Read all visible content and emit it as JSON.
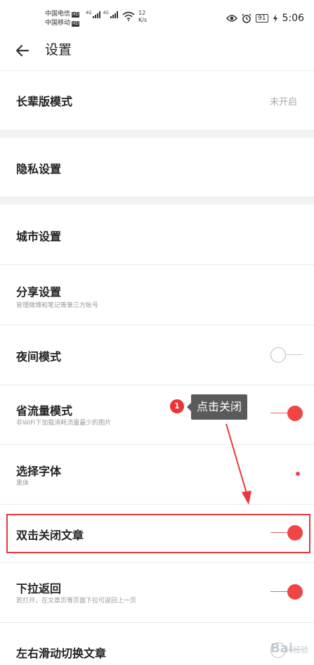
{
  "status_bar": {
    "carrier1": "中国电信",
    "carrier2": "中国移动",
    "hd": "HD",
    "net1": "4G",
    "net2": "4G",
    "speed_value": "12",
    "speed_unit": "K/s",
    "battery": "91",
    "time": "5:06"
  },
  "header": {
    "title": "设置"
  },
  "settings": {
    "elder_mode": {
      "label": "长辈版模式",
      "value": "未开启"
    },
    "privacy": {
      "label": "隐私设置"
    },
    "city": {
      "label": "城市设置"
    },
    "share": {
      "label": "分享设置",
      "sub": "管理微博和笔记等第三方帐号"
    },
    "night_mode": {
      "label": "夜间模式",
      "on": false
    },
    "data_saver": {
      "label": "省流量模式",
      "sub": "非WiFi下加载消耗流量最少的图片",
      "on": true
    },
    "font": {
      "label": "选择字体",
      "sub": "黑体"
    },
    "double_tap_close": {
      "label": "双击关闭文章",
      "on": true
    },
    "pull_back": {
      "label": "下拉返回",
      "sub": "若打开，在文章页等页面下拉可返回上一页",
      "on": true
    },
    "swipe_switch": {
      "label": "左右滑动切换文章",
      "on": false
    }
  },
  "annotation": {
    "step": "1",
    "text": "点击关闭"
  },
  "watermark": {
    "brand": "Bai",
    "suffix": "经验"
  },
  "colors": {
    "accent": "#f04545",
    "highlight_border": "#e8383d",
    "tooltip_bg": "#5a5a5a"
  }
}
